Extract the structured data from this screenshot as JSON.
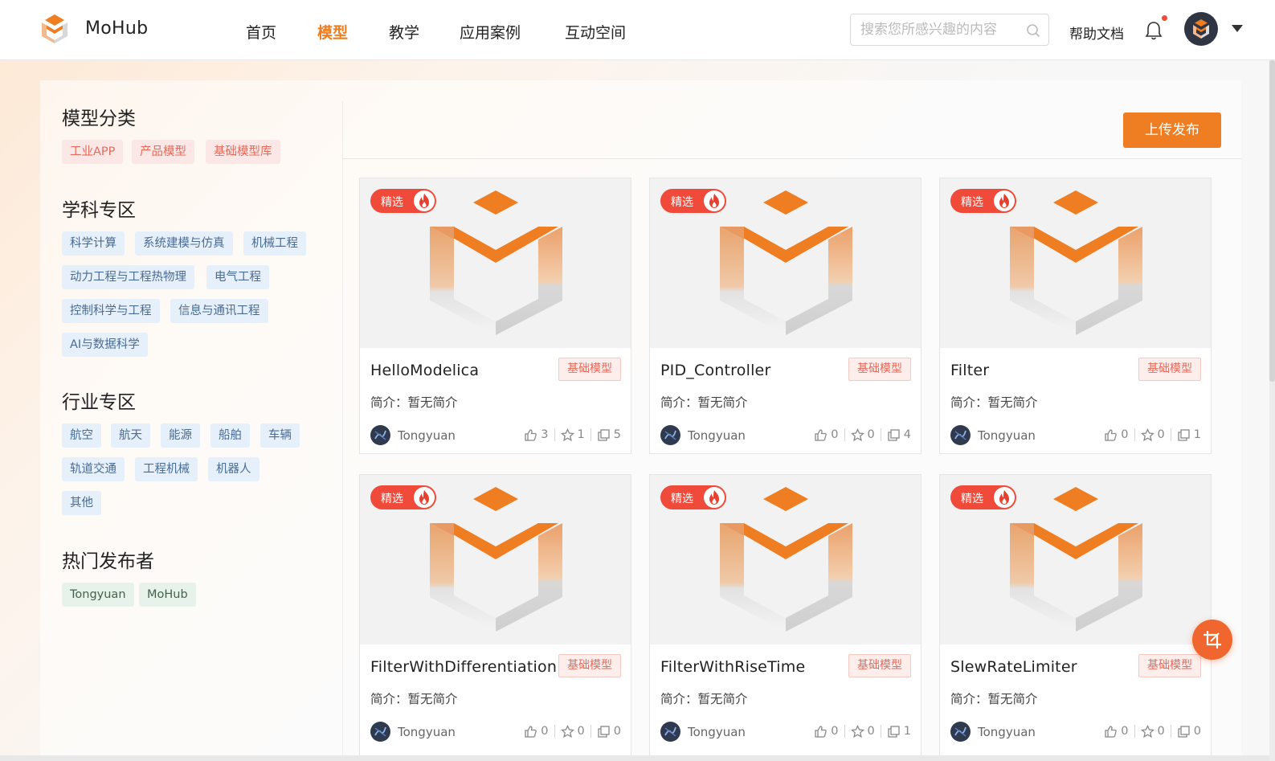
{
  "header": {
    "brand": "MoHub",
    "nav": [
      "首页",
      "模型",
      "教学",
      "应用案例",
      "互动空间"
    ],
    "active_nav": "模型",
    "search_placeholder": "搜索您所感兴趣的内容",
    "help": "帮助文档"
  },
  "colors": {
    "accent": "#ef7d22",
    "badge": "#f04a3a",
    "tag_red": "#e36b5d"
  },
  "sidebar": {
    "model_category": {
      "title": "模型分类",
      "tags": [
        "工业APP",
        "产品模型",
        "基础模型库"
      ]
    },
    "discipline": {
      "title": "学科专区",
      "tags": [
        "科学计算",
        "系统建模与仿真",
        "机械工程",
        "动力工程与工程热物理",
        "电气工程",
        "控制科学与工程",
        "信息与通讯工程",
        "AI与数据科学"
      ]
    },
    "industry": {
      "title": "行业专区",
      "tags": [
        "航空",
        "航天",
        "能源",
        "船舶",
        "车辆",
        "轨道交通",
        "工程机械",
        "机器人",
        "其他"
      ]
    },
    "publishers": {
      "title": "热门发布者",
      "tags": [
        "Tongyuan",
        "MoHub"
      ]
    }
  },
  "upload_button": "上传发布",
  "cards": [
    {
      "badge": "精选",
      "title": "HelloModelica",
      "tag": "基础模型",
      "desc": "简介：暂无简介",
      "author": "Tongyuan",
      "likes": "3",
      "stars": "1",
      "copies": "5"
    },
    {
      "badge": "精选",
      "title": "PID_Controller",
      "tag": "基础模型",
      "desc": "简介：暂无简介",
      "author": "Tongyuan",
      "likes": "0",
      "stars": "0",
      "copies": "4"
    },
    {
      "badge": "精选",
      "title": "Filter",
      "tag": "基础模型",
      "desc": "简介：暂无简介",
      "author": "Tongyuan",
      "likes": "0",
      "stars": "0",
      "copies": "1"
    },
    {
      "badge": "精选",
      "title": "FilterWithDifferentiation",
      "tag": "基础模型",
      "desc": "简介：暂无简介",
      "author": "Tongyuan",
      "likes": "0",
      "stars": "0",
      "copies": "0"
    },
    {
      "badge": "精选",
      "title": "FilterWithRiseTime",
      "tag": "基础模型",
      "desc": "简介：暂无简介",
      "author": "Tongyuan",
      "likes": "0",
      "stars": "0",
      "copies": "1"
    },
    {
      "badge": "精选",
      "title": "SlewRateLimiter",
      "tag": "基础模型",
      "desc": "简介：暂无简介",
      "author": "Tongyuan",
      "likes": "0",
      "stars": "0",
      "copies": "0"
    }
  ]
}
